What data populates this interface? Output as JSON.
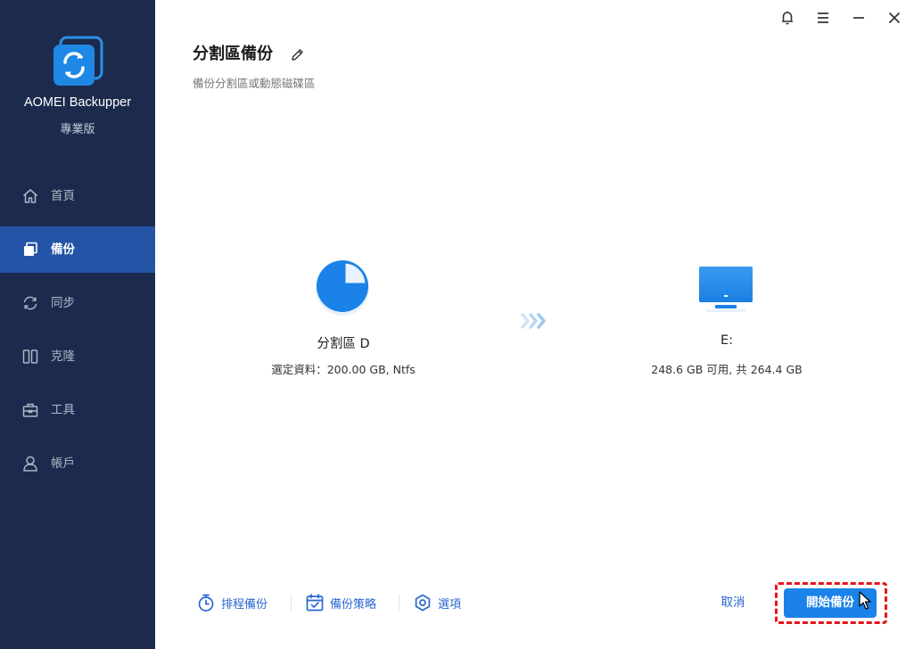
{
  "app": {
    "name": "AOMEI Backupper",
    "edition": "專業版"
  },
  "sidebar": {
    "items": [
      {
        "label": "首頁",
        "icon": "home-icon",
        "active": false
      },
      {
        "label": "備份",
        "icon": "backup-icon",
        "active": true
      },
      {
        "label": "同步",
        "icon": "sync-icon",
        "active": false
      },
      {
        "label": "克隆",
        "icon": "clone-icon",
        "active": false
      },
      {
        "label": "工具",
        "icon": "toolbox-icon",
        "active": false
      },
      {
        "label": "帳戶",
        "icon": "user-icon",
        "active": false
      }
    ]
  },
  "window_controls": [
    "bell-icon",
    "menu-icon",
    "minimize-icon",
    "close-icon"
  ],
  "header": {
    "title": "分割區備份",
    "subtitle": "備份分割區或動態磁碟區"
  },
  "source": {
    "name": "分割區 D",
    "info": "選定資料：200.00 GB, Ntfs",
    "icon": "partition-pie-icon"
  },
  "destination": {
    "name": "E:",
    "info": "248.6 GB 可用, 共 264.4 GB",
    "icon": "monitor-icon"
  },
  "bottom_bar": {
    "schedule_label": "排程備份",
    "scheme_label": "備份策略",
    "options_label": "選項",
    "cancel_label": "取消",
    "start_label": "開始備份"
  },
  "colors": {
    "sidebar_bg": "#1c2b4d",
    "sidebar_active": "#2354a6",
    "accent": "#1a82e8",
    "link": "#2a66d0",
    "highlight": "#e8141b"
  }
}
